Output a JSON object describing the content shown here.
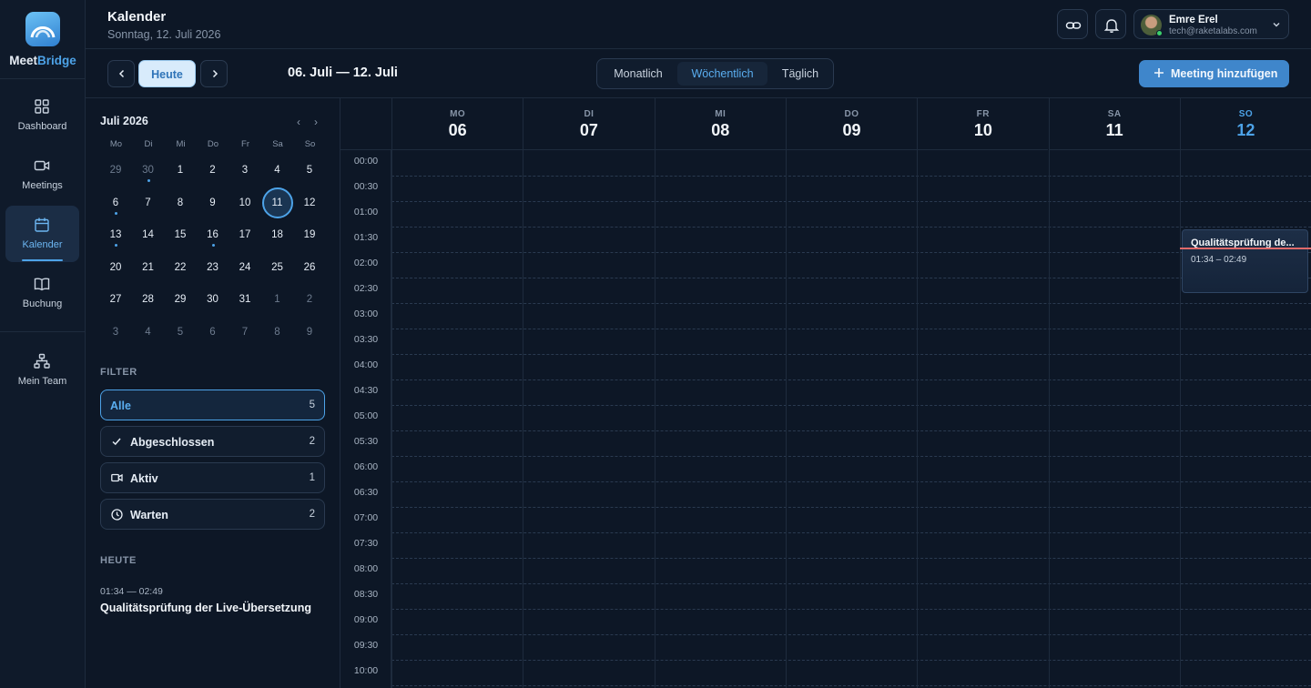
{
  "app": {
    "brand_part1": "Meet",
    "brand_part2": "Bridge",
    "accent_color": "#4da3e8"
  },
  "nav": [
    {
      "label": "Dashboard",
      "icon": "grid-icon",
      "active": false
    },
    {
      "label": "Meetings",
      "icon": "video-icon",
      "active": false
    },
    {
      "label": "Kalender",
      "icon": "calendar-icon",
      "active": true
    },
    {
      "label": "Buchung",
      "icon": "book-icon",
      "active": false
    },
    {
      "label": "Mein Team",
      "icon": "team-icon",
      "active": false
    }
  ],
  "header": {
    "title": "Kalender",
    "subtitle": "Sonntag, 12. Juli 2026",
    "user_name": "Emre Erel",
    "user_email": "tech@raketalabs.com"
  },
  "toolbar": {
    "today_label": "Heute",
    "range_label": "06. Juli — 12. Juli",
    "views": [
      "Monatlich",
      "Wöchentlich",
      "Täglich"
    ],
    "active_view": "Wöchentlich",
    "add_label": "Meeting hinzufügen"
  },
  "mini_calendar": {
    "title": "Juli 2026",
    "weekdays": [
      "Mo",
      "Di",
      "Mi",
      "Do",
      "Fr",
      "Sa",
      "So"
    ],
    "weeks": [
      [
        "29",
        "30",
        "1",
        "2",
        "3",
        "4",
        "5"
      ],
      [
        "6",
        "7",
        "8",
        "9",
        "10",
        "11",
        "12"
      ],
      [
        "13",
        "14",
        "15",
        "16",
        "17",
        "18",
        "19"
      ],
      [
        "20",
        "21",
        "22",
        "23",
        "24",
        "25",
        "26"
      ],
      [
        "27",
        "28",
        "29",
        "30",
        "31",
        "1",
        "2"
      ],
      [
        "3",
        "4",
        "5",
        "6",
        "7",
        "8",
        "9"
      ]
    ],
    "selected_day": "11"
  },
  "filters": {
    "section_label": "FILTER",
    "items": [
      {
        "label": "Alle",
        "count": "5",
        "icon": "",
        "active": true
      },
      {
        "label": "Abgeschlossen",
        "count": "2",
        "icon": "check-icon",
        "active": false
      },
      {
        "label": "Aktiv",
        "count": "1",
        "icon": "video-icon",
        "active": false
      },
      {
        "label": "Warten",
        "count": "2",
        "icon": "clock-icon",
        "active": false
      }
    ]
  },
  "agenda": {
    "section_label": "HEUTE",
    "time": "01:34 — 02:49",
    "title": "Qualitätsprüfung der Live-Übersetzung"
  },
  "week": {
    "days": [
      {
        "name": "MO",
        "date": "06",
        "today": false
      },
      {
        "name": "DI",
        "date": "07",
        "today": false
      },
      {
        "name": "MI",
        "date": "08",
        "today": false
      },
      {
        "name": "DO",
        "date": "09",
        "today": false
      },
      {
        "name": "FR",
        "date": "10",
        "today": false
      },
      {
        "name": "SA",
        "date": "11",
        "today": false
      },
      {
        "name": "SO",
        "date": "12",
        "today": true
      }
    ],
    "times": [
      "00:00",
      "00:30",
      "01:00",
      "01:30",
      "02:00",
      "02:30",
      "03:00",
      "03:30",
      "04:00",
      "04:30",
      "05:00",
      "05:30",
      "06:00",
      "06:30",
      "07:00",
      "07:30",
      "08:00",
      "08:30",
      "09:00",
      "09:30",
      "10:00"
    ],
    "event": {
      "title": "Qualitätsprüfung de...",
      "time": "01:34 – 02:49"
    }
  }
}
